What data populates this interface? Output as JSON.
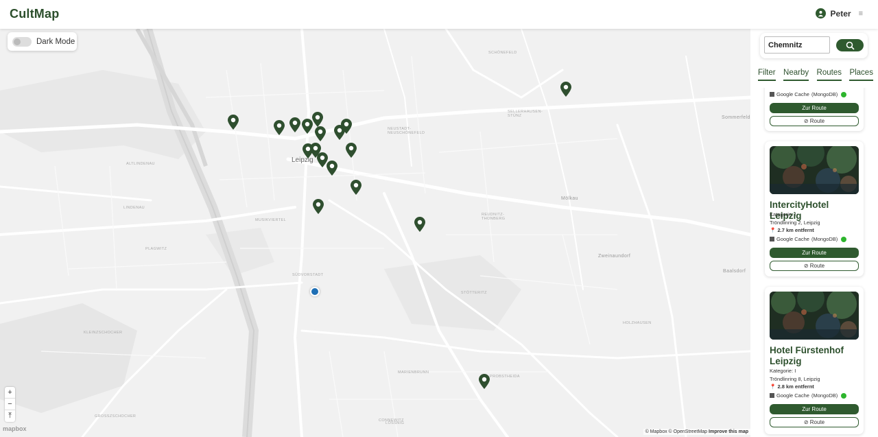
{
  "app": {
    "title": "CultMap"
  },
  "user": {
    "name": "Peter",
    "menu_icon": "≡"
  },
  "map": {
    "dark_mode_label": "Dark Mode",
    "city_label": "Leipzig",
    "district_labels": [
      "SCHÖNEFELD",
      "NEUSTADT-NEUSCHÖNEFELD",
      "SELLERHAUSEN-STÜNZ",
      "ALTLINDENAU",
      "LINDENAU",
      "MUSIKVIERTEL",
      "PLAGWITZ",
      "SÜDVORSTADT",
      "STÖTTERITZ",
      "KLEINZSCHOCHER",
      "MARIENBRUNN",
      "PROBSTHEIDA",
      "HOLZHAUSEN",
      "CONNEWITZ",
      "GROSSZSCHOCHER",
      "LÖSSNIG",
      "REUDNITZ-THONBERG",
      "Mölkau",
      "Zweinaundorf",
      "Baalsdorf",
      "Sommerfeld"
    ],
    "zoom_in": "+",
    "zoom_out": "−",
    "reset": "⤒",
    "mapbox_logo": "mapbox",
    "attribution": {
      "mapbox": "© Mapbox",
      "osm": "© OpenStreetMap",
      "improve": "Improve this map"
    }
  },
  "search": {
    "value": "Chemnitz"
  },
  "tabs": [
    "Filter",
    "Nearby",
    "Routes",
    "Places"
  ],
  "cards": [
    {
      "source": "Google Cache",
      "source_db": "(MongoDB)",
      "route_primary": "Zur Route",
      "route_secondary": "Route"
    },
    {
      "title": "IntercityHotel Leipzig",
      "category": "Kategorie: I",
      "address": "Tröndlinring 2, Leipzig",
      "distance": "2.7 km entfernt",
      "source": "Google Cache",
      "source_db": "(MongoDB)",
      "route_primary": "Zur Route",
      "route_secondary": "Route"
    },
    {
      "title": "Hotel Fürstenhof Leipzig",
      "category": "Kategorie: I",
      "address": "Tröndlinring 8, Leipzig",
      "distance": "2.8 km entfernt",
      "source": "Google Cache",
      "source_db": "(MongoDB)",
      "route_primary": "Zur Route",
      "route_secondary": "Route"
    }
  ],
  "colors": {
    "accent": "#2f5a2f",
    "user_location": "#1f6fb5",
    "status_ok": "#2db52d"
  }
}
